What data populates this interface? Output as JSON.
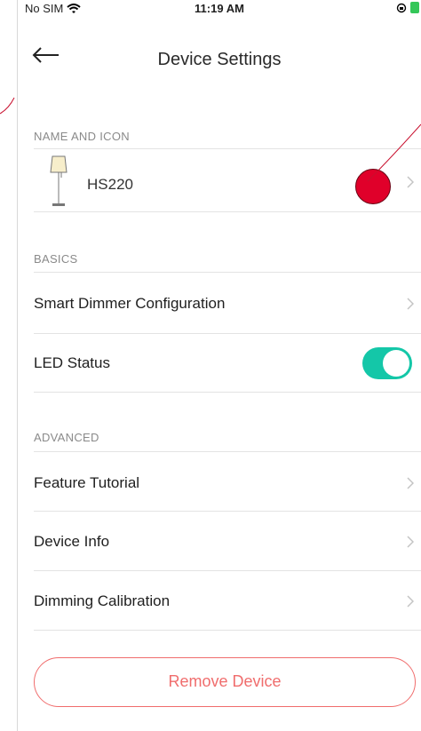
{
  "status_bar": {
    "carrier": "No SIM",
    "time": "11:19 AM"
  },
  "nav": {
    "title": "Device Settings"
  },
  "sections": {
    "name_and_icon": "NAME AND ICON",
    "basics": "BASICS",
    "advanced": "ADVANCED"
  },
  "device": {
    "name": "HS220"
  },
  "basics": {
    "smart_dimmer": "Smart Dimmer Configuration",
    "led_status": "LED Status",
    "led_status_on": true
  },
  "advanced": {
    "feature_tutorial": "Feature Tutorial",
    "device_info": "Device Info",
    "dimming_calibration": "Dimming Calibration"
  },
  "remove_button": "Remove Device",
  "colors": {
    "accent_toggle": "#14c7a8",
    "danger": "#f06d6d",
    "marker": "#e0002a"
  },
  "icons": [
    "wifi-icon",
    "back-arrow-icon",
    "lamp-icon",
    "chevron-right-icon",
    "battery-icon",
    "rotation-lock-icon"
  ]
}
